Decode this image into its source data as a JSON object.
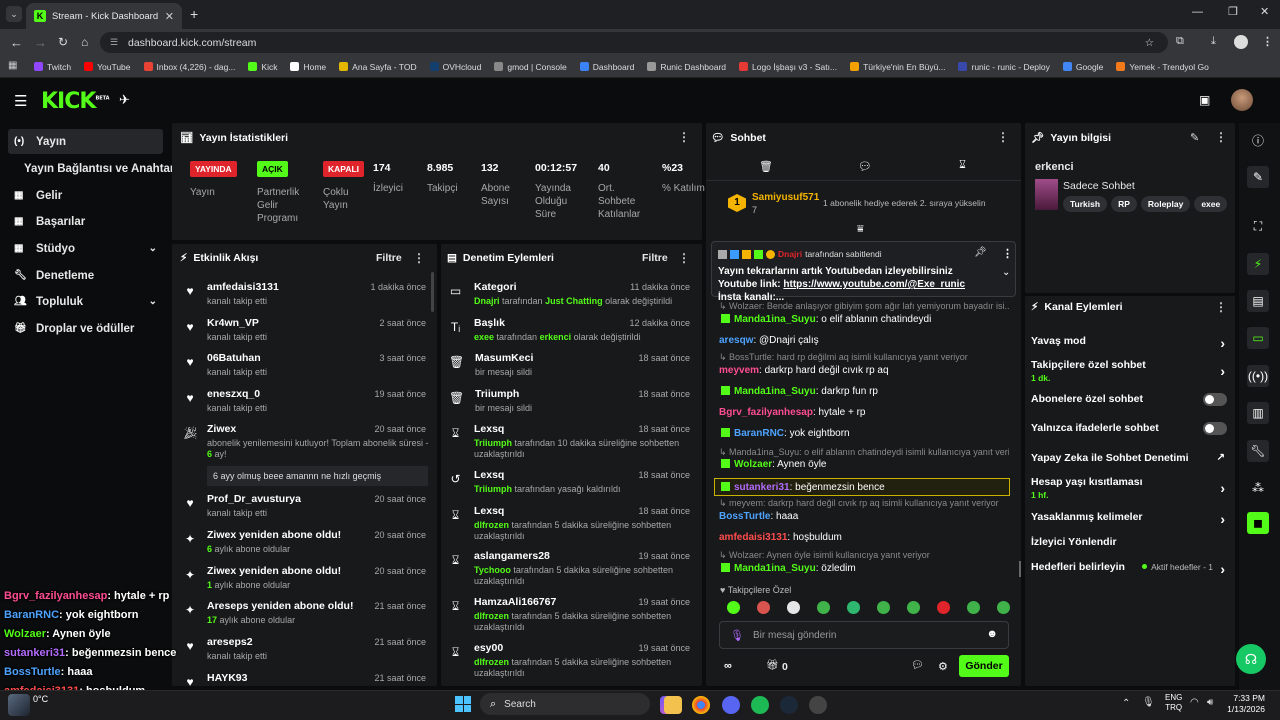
{
  "browser": {
    "tab_title": "Stream - Kick Dashboard",
    "url": "dashboard.kick.com/stream",
    "bookmarks": [
      {
        "label": "Twitch",
        "color": "#9146ff"
      },
      {
        "label": "YouTube",
        "color": "#ff0000"
      },
      {
        "label": "Inbox (4,226) - dag...",
        "color": "#ea4335"
      },
      {
        "label": "Kick",
        "color": "#53fc18"
      },
      {
        "label": "Home",
        "color": "#ffffff"
      },
      {
        "label": "Ana Sayfa - TOD",
        "color": "#e3b600"
      },
      {
        "label": "OVHcloud",
        "color": "#123f6d"
      },
      {
        "label": "gmod | Console",
        "color": "#888888"
      },
      {
        "label": "Dashboard",
        "color": "#3b82f6"
      },
      {
        "label": "Runic Dashboard",
        "color": "#999999"
      },
      {
        "label": "Logo İşbaşı v3 - Satı...",
        "color": "#e53935"
      },
      {
        "label": "Türkiye'nin En Büyü...",
        "color": "#f4a100"
      },
      {
        "label": "runic - runic - Deploy",
        "color": "#3949ab"
      },
      {
        "label": "Google",
        "color": "#4285f4"
      },
      {
        "label": "Yemek - Trendyol Go",
        "color": "#f27a1a"
      }
    ]
  },
  "app": {
    "logo": "KICK",
    "logo_sup": "BETA"
  },
  "sidebar": {
    "items": [
      {
        "label": "Yayın",
        "icon": "broadcast-icon"
      },
      {
        "label": "Yayın Bağlantısı ve Anahtarı",
        "icon": ""
      },
      {
        "label": "Gelir",
        "icon": "grid-icon"
      },
      {
        "label": "Başarılar",
        "icon": "grid-icon"
      },
      {
        "label": "Stüdyo",
        "icon": "grid-icon"
      },
      {
        "label": "Denetleme",
        "icon": "wrench-icon"
      },
      {
        "label": "Topluluk",
        "icon": "people-icon"
      },
      {
        "label": "Droplar ve ödüller",
        "icon": "gift-icon"
      }
    ]
  },
  "stats": {
    "title": "Yayın İstatistikleri",
    "badges": [
      {
        "badge": "YAYINDA",
        "label": "Yayın",
        "bg": "#e0242b",
        "fg": "#ffffff"
      },
      {
        "badge": "AÇIK",
        "label": "Partnerlik Gelir Programı",
        "bg": "#53fc18",
        "fg": "#000000"
      },
      {
        "badge": "KAPALI",
        "label": "Çoklu Yayın",
        "bg": "#e0242b",
        "fg": "#ffffff"
      }
    ],
    "values": [
      {
        "value": "174",
        "label": "İzleyici"
      },
      {
        "value": "8.985",
        "label": "Takipçi"
      },
      {
        "value": "132",
        "label": "Abone Sayısı"
      },
      {
        "value": "00:12:57",
        "label": "Yayında Olduğu Süre"
      },
      {
        "value": "40",
        "label": "Ort. Sohbete Katılanlar"
      },
      {
        "value": "%23",
        "label": "% Katılım"
      }
    ]
  },
  "activity": {
    "title": "Etkinlik Akışı",
    "filter": "Filtre",
    "items": [
      {
        "name": "amfedaisi3131",
        "sub": "kanalı takip etti",
        "time": "1 dakika önce",
        "icon": "heart-icon"
      },
      {
        "name": "Kr4wn_VP",
        "sub": "kanalı takip etti",
        "time": "2 saat önce",
        "icon": "heart-icon"
      },
      {
        "name": "06Batuhan",
        "sub": "kanalı takip etti",
        "time": "3 saat önce",
        "icon": "heart-icon"
      },
      {
        "name": "eneszxq_0",
        "sub": "kanalı takip etti",
        "time": "19 saat önce",
        "icon": "heart-icon"
      },
      {
        "name": "Ziwex",
        "sub": "abonelik yenilemesini kutluyor! Toplam abonelik süresi - ",
        "sub_hl": "6",
        "sub2": " ay!",
        "msg": "6 ayy olmuş beee amannn ne hızlı geçmiş",
        "time": "20 saat önce",
        "icon": "party-icon"
      },
      {
        "name": "Prof_Dr_avusturya",
        "sub": "kanalı takip etti",
        "time": "20 saat önce",
        "icon": "heart-icon"
      },
      {
        "name": "Ziwex yeniden abone oldu!",
        "sub_hl": "6",
        "sub": " aylık abone oldular",
        "time": "20 saat önce",
        "icon": "sparkle-icon"
      },
      {
        "name": "Ziwex yeniden abone oldu!",
        "sub_hl": "1",
        "sub": " aylık abone oldular",
        "time": "20 saat önce",
        "icon": "sparkle-icon"
      },
      {
        "name": "Areseps yeniden abone oldu!",
        "sub_hl": "17",
        "sub": " aylık abone oldular",
        "time": "21 saat önce",
        "icon": "sparkle-icon"
      },
      {
        "name": "areseps2",
        "sub": "kanalı takip etti",
        "time": "21 saat önce",
        "icon": "heart-icon"
      },
      {
        "name": "HAYK93",
        "sub": "",
        "time": "21 saat önce",
        "icon": "heart-icon"
      }
    ]
  },
  "moderation": {
    "title": "Denetim Eylemleri",
    "filter": "Filtre",
    "items": [
      {
        "name": "Kategori",
        "actor": "Dnajri",
        "mid": " tarafından ",
        "hl": "Just Chatting",
        "tail": " olarak değiştirildi",
        "time": "11 dakika önce",
        "icon": "category-icon"
      },
      {
        "name": "Başlık",
        "actor": "exee",
        "mid": " tarafından ",
        "hl": "erkenci",
        "tail": " olarak değiştirildi",
        "time": "12 dakika önce",
        "icon": "title-icon"
      },
      {
        "name": "MasumKeci",
        "actor": "",
        "mid": "bir mesajı sildi",
        "hl": "",
        "tail": "",
        "time": "18 saat önce",
        "icon": "trash-icon"
      },
      {
        "name": "Triiumph",
        "actor": "",
        "mid": "bir mesajı sildi",
        "hl": "",
        "tail": "",
        "time": "18 saat önce",
        "icon": "trash-icon"
      },
      {
        "name": "Lexsq",
        "actor": "Triiumph",
        "mid": " tarafından 10 dakika süreliğine sohbetten uzaklaştırıldı",
        "hl": "",
        "tail": "",
        "time": "18 saat önce",
        "icon": "hourglass-icon"
      },
      {
        "name": "Lexsq",
        "actor": "Triiumph",
        "mid": " tarafından yasağı kaldırıldı",
        "hl": "",
        "tail": "",
        "time": "18 saat önce",
        "icon": "undo-icon"
      },
      {
        "name": "Lexsq",
        "actor": "dlfrozen",
        "mid": " tarafından 5 dakika süreliğine sohbetten uzaklaştırıldı",
        "hl": "",
        "tail": "",
        "time": "18 saat önce",
        "icon": "hourglass-icon"
      },
      {
        "name": "aslangamers28",
        "actor": "Tychooo",
        "mid": " tarafından 5 dakika süreliğine sohbetten uzaklaştırıldı",
        "hl": "",
        "tail": "",
        "time": "19 saat önce",
        "icon": "hourglass-icon"
      },
      {
        "name": "HamzaAli166767",
        "actor": "dlfrozen",
        "mid": " tarafından 5 dakika süreliğine sohbetten uzaklaştırıldı",
        "hl": "",
        "tail": "",
        "time": "19 saat önce",
        "icon": "hourglass-icon"
      },
      {
        "name": "esy00",
        "actor": "dlfrozen",
        "mid": " tarafından 5 dakika süreliğine sohbetten uzaklaştırıldı",
        "hl": "",
        "tail": "",
        "time": "19 saat önce",
        "icon": "hourglass-icon"
      }
    ]
  },
  "chat": {
    "title": "Sohbet",
    "top_user": "Samiyusuf571",
    "top_user_rank": "7",
    "top_text": "1 abonelik hediye ederek 2. sıraya yükselin",
    "pinned_by": "Dnajri",
    "pinned_label": "tarafından sabitlendi",
    "pinned_text": "Yayın tekrarlarını artık Youtubedan izleyebilirsiniz Youtube link: ",
    "pinned_link": "https://www.youtube.com/@Exe_runic",
    "pinned_tail": " İnsta kanalı:...",
    "lines": [
      {
        "type": "reply",
        "text": "Wolzaer: Bende anlaşıyor gibiyim şom ağır lafı yemiyorum bayadır isi..."
      },
      {
        "type": "msg",
        "user": "Manda1ina_Suyu",
        "color": "#53fc18",
        "text": ": o elif ablanın chatindeydi",
        "badge": true
      },
      {
        "type": "msg",
        "user": "aresqw",
        "color": "#4da3ff",
        "text": ": @Dnajri çalış",
        "badge": false
      },
      {
        "type": "reply",
        "text": "BossTurtle: hard rp değilmi aq isimli kullanıcıya yanıt veriyor"
      },
      {
        "type": "msg",
        "user": "meyvem",
        "color": "#ff4d94",
        "text": ": darkrp hard değil cıvık rp aq",
        "badge": false
      },
      {
        "type": "msg",
        "user": "Manda1ina_Suyu",
        "color": "#53fc18",
        "text": ": darkrp fun rp",
        "badge": true
      },
      {
        "type": "msg",
        "user": "Bgrv_fazilyanhesap",
        "color": "#ff4d94",
        "text": ": hytale + rp",
        "badge": false
      },
      {
        "type": "msg",
        "user": "BaranRNC",
        "color": "#4da3ff",
        "text": ": yok eightborn",
        "badge": true
      },
      {
        "type": "reply",
        "text": "Manda1ina_Suyu: o elif ablanın chatindeydi isimli kullanıcıya yanıt veriy"
      },
      {
        "type": "msg",
        "user": "Wolzaer",
        "color": "#53fc18",
        "text": ": Aynen öyle",
        "badge": true
      },
      {
        "type": "msg",
        "user": "sutankeri31",
        "color": "#b36bff",
        "text": ": beğenmezsin bence",
        "badge": true
      },
      {
        "type": "reply",
        "text": "meyvem: darkrp hard değil cıvık rp aq isimli kullanıcıya yanıt veriyor"
      },
      {
        "type": "msg",
        "user": "BossTurtle",
        "color": "#4da3ff",
        "text": ": haaa",
        "badge": false
      },
      {
        "type": "msg",
        "user": "amfedaisi3131",
        "color": "#ff4d4d",
        "text": ": hoşbuldum",
        "badge": false
      },
      {
        "type": "reply",
        "text": "Wolzaer: Aynen öyle isimli kullanıcıya yanıt veriyor"
      },
      {
        "type": "msg",
        "user": "Manda1ina_Suyu",
        "color": "#53fc18",
        "text": ": özledim",
        "badge": true
      }
    ],
    "followers_only": "Takipçilere Özel",
    "placeholder": "Bir mesaj gönderin",
    "count": "0",
    "send": "Gönder"
  },
  "info": {
    "title": "Yayın bilgisi",
    "stream_title": "erkenci",
    "category": "Sadece Sohbet",
    "tags": [
      "Turkish",
      "RP",
      "Roleplay",
      "exee"
    ]
  },
  "channel": {
    "title": "Kanal Eylemleri",
    "items": [
      {
        "label": "Yavaş mod",
        "sub": "",
        "ctl": "chevron"
      },
      {
        "label": "Takipçilere özel sohbet",
        "sub": "1 dk.",
        "ctl": "chevron"
      },
      {
        "label": "Abonelere özel sohbet",
        "sub": "",
        "ctl": "toggle"
      },
      {
        "label": "Yalnızca ifadelerle sohbet",
        "sub": "",
        "ctl": "toggle"
      },
      {
        "label": "Yapay Zeka ile Sohbet Denetimi",
        "sub": "",
        "ctl": "ext"
      },
      {
        "label": "Hesap yaşı kısıtlaması",
        "sub": "1 hf.",
        "ctl": "chevron"
      },
      {
        "label": "Yasaklanmış kelimeler",
        "sub": "",
        "ctl": "chevron"
      },
      {
        "label": "İzleyici Yönlendir",
        "sub": "",
        "ctl": ""
      },
      {
        "label": "Hedefleri belirleyin",
        "sub": "",
        "ctl": "chevron",
        "status": "Aktif hedefler - 1"
      }
    ]
  },
  "overlay": [
    {
      "user": "Bgrv_fazilyanhesap",
      "color": "#ff4d94",
      "text": ": hytale + rp"
    },
    {
      "user": "BaranRNC",
      "color": "#4da3ff",
      "text": ": yok eightborn"
    },
    {
      "user": "Wolzaer",
      "color": "#53fc18",
      "text": ": Aynen öyle"
    },
    {
      "user": "sutankeri31",
      "color": "#b36bff",
      "text": ": beğenmezsin bence"
    },
    {
      "user": "BossTurtle",
      "color": "#4da3ff",
      "text": ": haaa"
    },
    {
      "user": "amfedaisi3131",
      "color": "#ff4d4d",
      "text": ": hoşbuldum"
    },
    {
      "user": "Manda1ina_Suyu",
      "color": "#53fc18",
      "text": ": özledim"
    }
  ],
  "taskbar": {
    "search": "Search",
    "weather": "0°C",
    "lang1": "ENG",
    "lang2": "TRQ",
    "time": "7:33 PM",
    "date": "1/13/2026"
  },
  "colors": {
    "accent": "#53fc18",
    "panel": "#18191b",
    "bg": "#0b0c0d",
    "live": "#e0242b"
  }
}
